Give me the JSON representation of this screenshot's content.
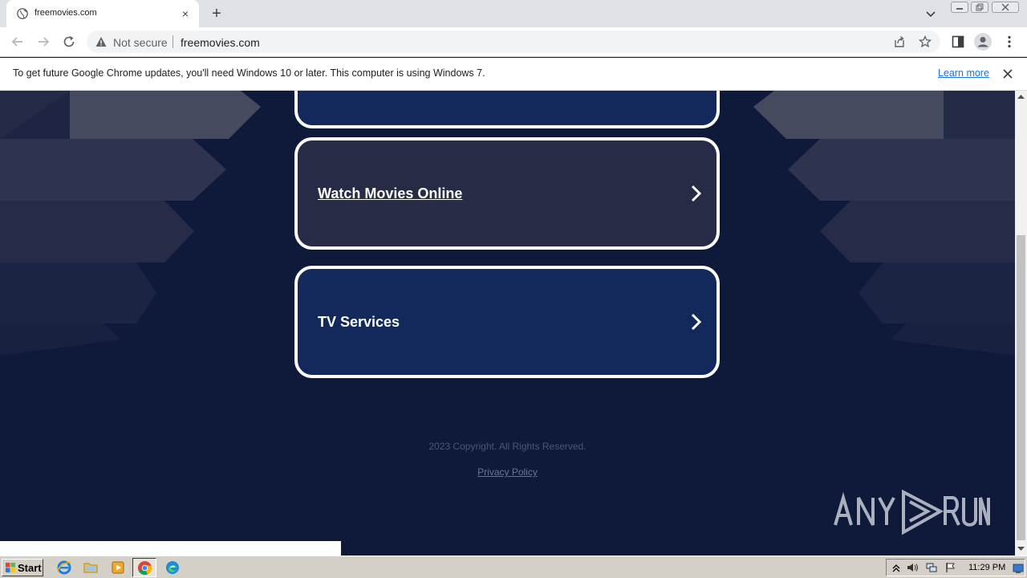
{
  "browser": {
    "tab_title": "freemovies.com",
    "tab_close": "×",
    "new_tab": "+",
    "security_label": "Not secure",
    "url": "freemovies.com",
    "icons": [
      "globe-icon",
      "close-icon",
      "plus-icon",
      "chevron-down-icon",
      "back-arrow-icon",
      "forward-arrow-icon",
      "reload-icon",
      "warning-icon",
      "share-icon",
      "star-icon",
      "side-panel-icon",
      "profile-icon",
      "kebab-menu-icon"
    ]
  },
  "infobar": {
    "message": "To get future Google Chrome updates, you'll need Windows 10 or later. This computer is using Windows 7.",
    "link": "Learn more"
  },
  "page": {
    "cards": [
      {
        "label": "",
        "bg": "#13285b"
      },
      {
        "label": "Watch Movies Online",
        "bg": "#272b45"
      },
      {
        "label": "TV Services",
        "bg": "#13285b"
      }
    ],
    "copyright": "2023 Copyright. All Rights Reserved.",
    "privacy": "Privacy Policy",
    "watermark": "ANY RUN",
    "colors": {
      "background": "#0f1a3b",
      "card_border": "#ffffff"
    }
  },
  "taskbar": {
    "start_label": "Start",
    "clock": "11:29 PM",
    "icons": [
      "internet-explorer-icon",
      "folder-icon",
      "media-player-icon",
      "chrome-icon",
      "edge-icon"
    ]
  }
}
